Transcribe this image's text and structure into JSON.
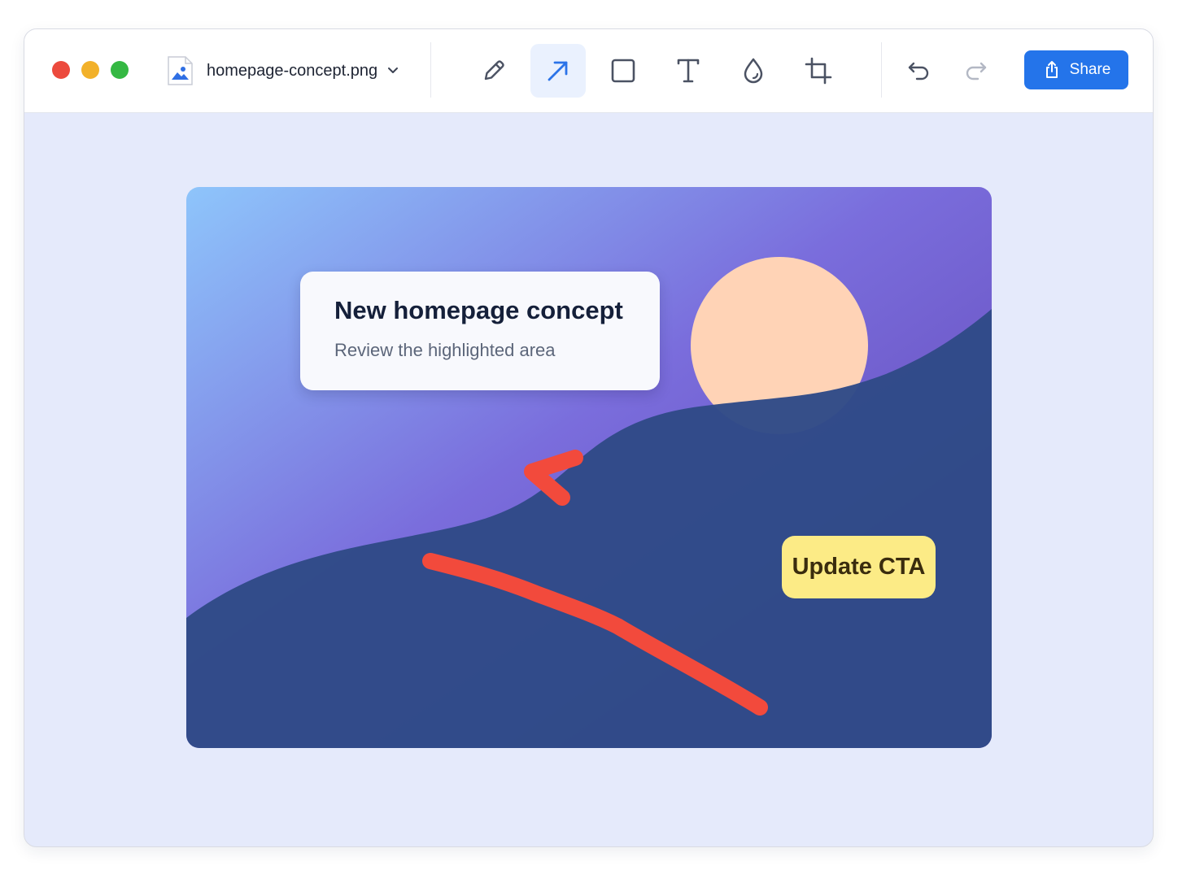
{
  "window": {
    "file_name": "homepage-concept.png",
    "file_icon": "image-file-icon"
  },
  "toolbar": {
    "tools": [
      {
        "name": "pen",
        "icon": "pen-icon",
        "active": false
      },
      {
        "name": "arrow",
        "icon": "arrow-icon",
        "active": true
      },
      {
        "name": "rectangle",
        "icon": "rectangle-icon",
        "active": false
      },
      {
        "name": "text",
        "icon": "text-icon",
        "active": false
      },
      {
        "name": "blur",
        "icon": "droplet-icon",
        "active": false
      },
      {
        "name": "crop",
        "icon": "crop-icon",
        "active": false
      }
    ],
    "undo_icon": "undo-icon",
    "redo_icon": "redo-icon",
    "share_label": "Share"
  },
  "canvas": {
    "card_title": "New homepage concept",
    "card_subtitle": "Review the highlighted area",
    "annotation_label": "Update CTA"
  },
  "colors": {
    "accent": "#2474ea",
    "arrow_annotation": "#f24a3c",
    "label_highlight": "#fceb86",
    "active_tool_bg": "#eaf1fe"
  }
}
